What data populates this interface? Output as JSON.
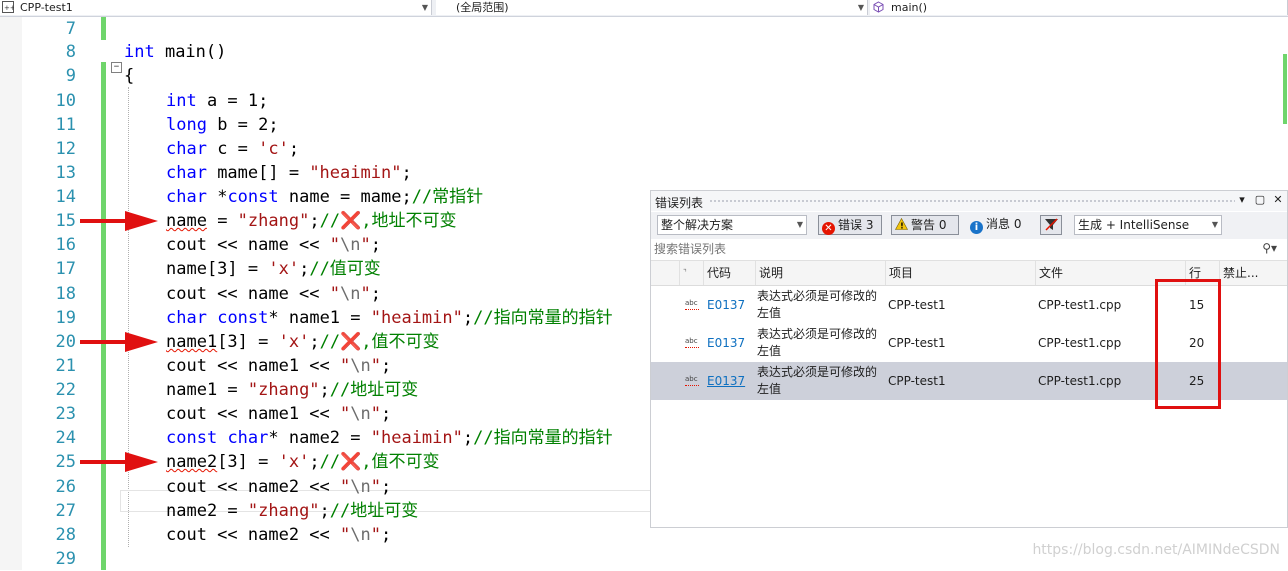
{
  "navbar": {
    "project": "CPP-test1",
    "scope": "(全局范围)",
    "function": "main()"
  },
  "editor": {
    "lines": [
      {
        "num": "7"
      },
      {
        "num": "8"
      },
      {
        "num": "9"
      },
      {
        "num": "10"
      },
      {
        "num": "11"
      },
      {
        "num": "12"
      },
      {
        "num": "13"
      },
      {
        "num": "14"
      },
      {
        "num": "15"
      },
      {
        "num": "16"
      },
      {
        "num": "17"
      },
      {
        "num": "18"
      },
      {
        "num": "19"
      },
      {
        "num": "20"
      },
      {
        "num": "21"
      },
      {
        "num": "22"
      },
      {
        "num": "23"
      },
      {
        "num": "24"
      },
      {
        "num": "25"
      },
      {
        "num": "26"
      },
      {
        "num": "27"
      },
      {
        "num": "28"
      },
      {
        "num": "29"
      }
    ],
    "tokens": {
      "l8_kw": "int",
      "l8_rest": " main()",
      "l9": "{",
      "l10_kw": "int",
      "l10_rest": " a = 1;",
      "l11_kw": "long",
      "l11_rest": " b = 2;",
      "l12_kw": "char",
      "l12_a": " c = ",
      "l12_str": "'c'",
      "l12_b": ";",
      "l13_kw": "char",
      "l13_a": " mame[] = ",
      "l13_str": "\"heaimin\"",
      "l13_b": ";",
      "l14_kw": "char",
      "l14_a": " *",
      "l14_kw2": "const",
      "l14_b": " name = mame;",
      "l14_cm": "//常指针",
      "l15_sq": "name",
      "l15_a": " = ",
      "l15_str": "\"zhang\"",
      "l15_b": ";",
      "l15_cm": "//❌,地址不可变",
      "l16_a": "cout << name << ",
      "l16_q1": "\"",
      "l16_esc": "\\n",
      "l16_q2": "\"",
      "l16_b": ";",
      "l17_a": "name[3] = ",
      "l17_str": "'x'",
      "l17_b": ";",
      "l17_cm": "//值可变",
      "l18_a": "cout << name << ",
      "l18_q1": "\"",
      "l18_esc": "\\n",
      "l18_q2": "\"",
      "l18_b": ";",
      "l19_kw": "char",
      "l19_sp": " ",
      "l19_kw2": "const",
      "l19_a": "* name1 = ",
      "l19_str": "\"heaimin\"",
      "l19_b": ";",
      "l19_cm": "//指向常量的指针",
      "l20_sq": "name1",
      "l20_a": "[3] = ",
      "l20_str": "'x'",
      "l20_b": ";",
      "l20_cm": "//❌,值不可变",
      "l21_a": "cout << name1 << ",
      "l21_q1": "\"",
      "l21_esc": "\\n",
      "l21_q2": "\"",
      "l21_b": ";",
      "l22_a": "name1 = ",
      "l22_str": "\"zhang\"",
      "l22_b": ";",
      "l22_cm": "//地址可变",
      "l23_a": "cout << name1 << ",
      "l23_q1": "\"",
      "l23_esc": "\\n",
      "l23_q2": "\"",
      "l23_b": ";",
      "l24_kw": "const",
      "l24_sp": " ",
      "l24_kw2": "char",
      "l24_a": "* name2 = ",
      "l24_str": "\"heaimin\"",
      "l24_b": ";",
      "l24_cm": "//指向常量的指针",
      "l25_sq": "name2",
      "l25_a": "[3] = ",
      "l25_str": "'x'",
      "l25_b": ";",
      "l25_cm": "//❌,值不可变",
      "l26_a": "cout << name2 << ",
      "l26_q1": "\"",
      "l26_esc": "\\n",
      "l26_q2": "\"",
      "l26_b": ";",
      "l27_a": "name2 = ",
      "l27_str": "\"zhang\"",
      "l27_b": ";",
      "l27_cm": "//地址可变",
      "l28_a": "cout << name2 << ",
      "l28_q1": "\"",
      "l28_esc": "\\n",
      "l28_q2": "\"",
      "l28_b": ";"
    }
  },
  "error_list": {
    "title": "错误列表",
    "scope_select": "整个解决方案",
    "errors_btn": "错误 3",
    "warnings_btn": "警告 0",
    "messages_btn": "消息 0",
    "build_select": "生成 + IntelliSense",
    "search_placeholder": "搜索错误列表",
    "headers": {
      "code": "代码",
      "desc": "说明",
      "project": "项目",
      "file": "文件",
      "line": "行",
      "suppress": "禁止..."
    },
    "rows": [
      {
        "code": "E0137",
        "desc1": "表达式必须是可修改的",
        "desc2": "左值",
        "project": "CPP-test1",
        "file": "CPP-test1.cpp",
        "line": "15"
      },
      {
        "code": "E0137",
        "desc1": "表达式必须是可修改的",
        "desc2": "左值",
        "project": "CPP-test1",
        "file": "CPP-test1.cpp",
        "line": "20"
      },
      {
        "code": "E0137",
        "desc1": "表达式必须是可修改的",
        "desc2": "左值",
        "project": "CPP-test1",
        "file": "CPP-test1.cpp",
        "line": "25"
      }
    ],
    "abc_label": "abc"
  },
  "watermark": "https://blog.csdn.net/AIMINdeCSDN",
  "colors": {
    "keyword": "#0000ff",
    "string": "#a31515",
    "comment": "#008000",
    "line_number": "#2b91af",
    "change_bar": "#6fd56b",
    "annotation_red": "#e01010",
    "link": "#0e70c0"
  }
}
